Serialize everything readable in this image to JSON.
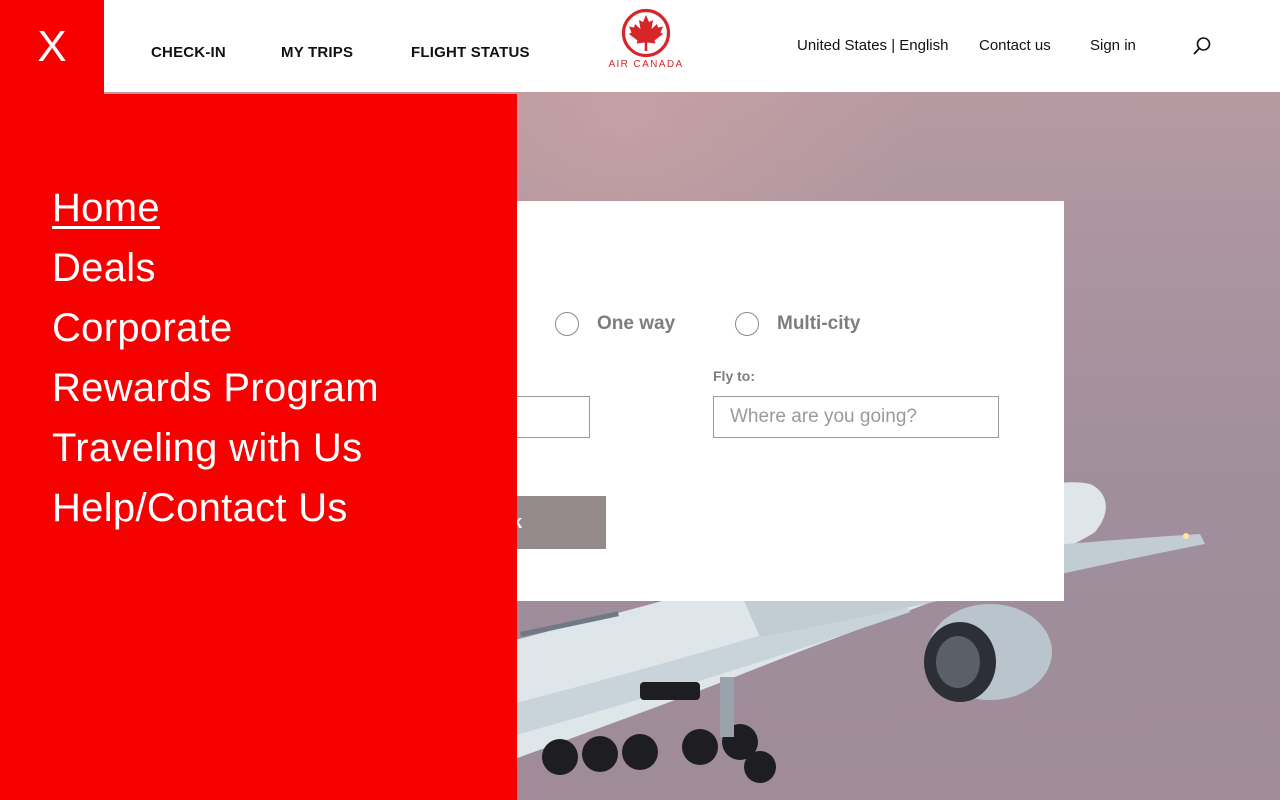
{
  "header": {
    "close_label": "X",
    "nav": [
      {
        "label": "CHECK-IN"
      },
      {
        "label": "MY TRIPS"
      },
      {
        "label": "FLIGHT STATUS"
      }
    ],
    "logo_text": "AIR CANADA",
    "locale": "United States | English",
    "contact": "Contact us",
    "sign_in": "Sign in",
    "search_icon": "search-icon"
  },
  "booking": {
    "trip_types": [
      {
        "label": "One way",
        "selected": false
      },
      {
        "label": "Multi-city",
        "selected": false
      }
    ],
    "fly_to_label": "Fly to:",
    "fly_to_placeholder": "Where are you going?",
    "fly_from_value": "",
    "submit_label_visible": "k"
  },
  "menu": {
    "items": [
      {
        "label": "Home",
        "active": true
      },
      {
        "label": "Deals",
        "active": false
      },
      {
        "label": "Corporate",
        "active": false
      },
      {
        "label": "Rewards Program",
        "active": false
      },
      {
        "label": "Traveling with Us",
        "active": false
      },
      {
        "label": "Help/Contact Us",
        "active": false
      }
    ]
  },
  "colors": {
    "brand_red": "#f70000",
    "logo_red": "#d6262a",
    "button_gray": "#958a8a"
  }
}
